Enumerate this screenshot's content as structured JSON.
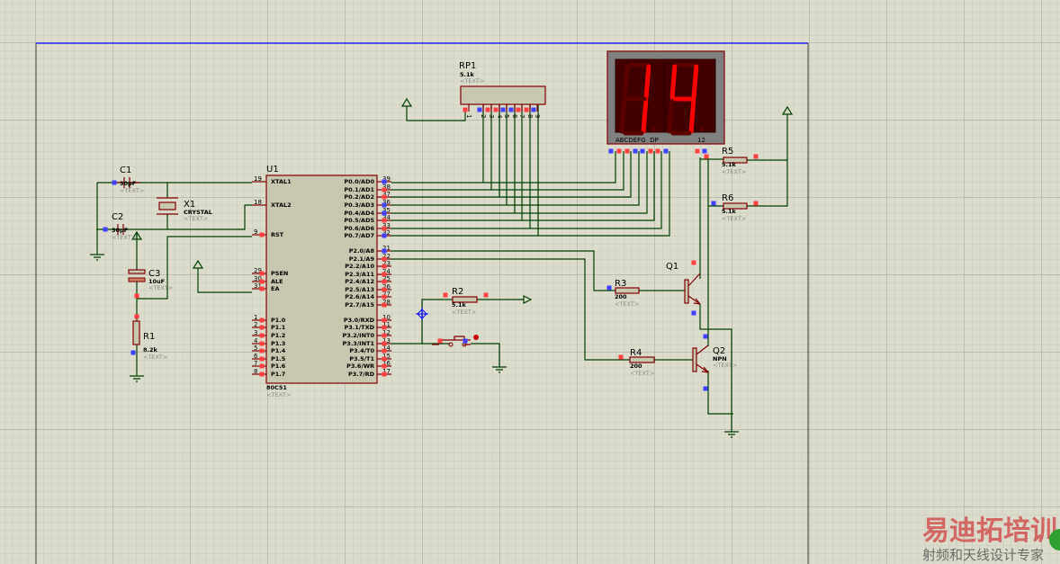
{
  "colors": {
    "wire": "#004000",
    "component": "#800000",
    "body_fill": "#c8c8b0",
    "pin_red": "#ff4040",
    "pin_blue": "#4040ff",
    "segment_on": "#ff0000",
    "segment_off": "#5a0000",
    "sheet_top": "#0000ff"
  },
  "u1": {
    "ref": "U1",
    "part": "80C51",
    "text": "<TEXT>",
    "left_pins": [
      {
        "num": "19",
        "name": "XTAL1"
      },
      {
        "num": "18",
        "name": "XTAL2"
      },
      {
        "num": "9",
        "name": "RST"
      },
      {
        "num": "29",
        "name": "PSEN"
      },
      {
        "num": "30",
        "name": "ALE"
      },
      {
        "num": "31",
        "name": "EA"
      },
      {
        "num": "1",
        "name": "P1.0"
      },
      {
        "num": "2",
        "name": "P1.1"
      },
      {
        "num": "3",
        "name": "P1.2"
      },
      {
        "num": "4",
        "name": "P1.3"
      },
      {
        "num": "5",
        "name": "P1.4"
      },
      {
        "num": "6",
        "name": "P1.5"
      },
      {
        "num": "7",
        "name": "P1.6"
      },
      {
        "num": "8",
        "name": "P1.7"
      }
    ],
    "right_pins": [
      {
        "num": "39",
        "name": "P0.0/AD0"
      },
      {
        "num": "38",
        "name": "P0.1/AD1"
      },
      {
        "num": "37",
        "name": "P0.2/AD2"
      },
      {
        "num": "36",
        "name": "P0.3/AD3"
      },
      {
        "num": "35",
        "name": "P0.4/AD4"
      },
      {
        "num": "34",
        "name": "P0.5/AD5"
      },
      {
        "num": "33",
        "name": "P0.6/AD6"
      },
      {
        "num": "32",
        "name": "P0.7/AD7"
      },
      {
        "num": "21",
        "name": "P2.0/A8"
      },
      {
        "num": "22",
        "name": "P2.1/A9"
      },
      {
        "num": "23",
        "name": "P2.2/A10"
      },
      {
        "num": "24",
        "name": "P2.3/A11"
      },
      {
        "num": "25",
        "name": "P2.4/A12"
      },
      {
        "num": "26",
        "name": "P2.5/A13"
      },
      {
        "num": "27",
        "name": "P2.6/A14"
      },
      {
        "num": "28",
        "name": "P2.7/A15"
      },
      {
        "num": "10",
        "name": "P3.0/RXD"
      },
      {
        "num": "11",
        "name": "P3.1/TXD"
      },
      {
        "num": "12",
        "name": "P3.2/INT0"
      },
      {
        "num": "13",
        "name": "P3.3/INT1"
      },
      {
        "num": "14",
        "name": "P3.4/T0"
      },
      {
        "num": "15",
        "name": "P3.5/T1"
      },
      {
        "num": "16",
        "name": "P3.6/WR"
      },
      {
        "num": "17",
        "name": "P3.7/RD"
      }
    ]
  },
  "rp1": {
    "ref": "RP1",
    "value": "5.1k",
    "text": "<TEXT>",
    "pins": [
      "1",
      "2",
      "3",
      "4",
      "5",
      "6",
      "7",
      "8",
      "9"
    ]
  },
  "display": {
    "digits": "14",
    "pin_labels": "ABCDEFG  DP",
    "common_labels": "12"
  },
  "components": [
    {
      "id": "c1",
      "ref": "C1",
      "value": "30pF",
      "text": "<TEXT>"
    },
    {
      "id": "c2",
      "ref": "C2",
      "value": "30pF",
      "text": "<TEXT>"
    },
    {
      "id": "x1",
      "ref": "X1",
      "value": "CRYSTAL",
      "text": "<TEXT>"
    },
    {
      "id": "c3",
      "ref": "C3",
      "value": "10uF",
      "text": "<TEXT>"
    },
    {
      "id": "r1",
      "ref": "R1",
      "value": "8.2k",
      "text": "<TEXT>"
    },
    {
      "id": "r2",
      "ref": "R2",
      "value": "5.1k",
      "text": "<TEXT>"
    },
    {
      "id": "r3",
      "ref": "R3",
      "value": "200",
      "text": "<TEXT>"
    },
    {
      "id": "r4",
      "ref": "R4",
      "value": "200",
      "text": "<TEXT>"
    },
    {
      "id": "q1",
      "ref": "Q1",
      "value": "",
      "text": ""
    },
    {
      "id": "q2",
      "ref": "Q2",
      "value": "NPN",
      "text": "<TEXT>"
    },
    {
      "id": "r5",
      "ref": "R5",
      "value": "5.1k",
      "text": "<TEXT>"
    },
    {
      "id": "r6",
      "ref": "R6",
      "value": "5.1k",
      "text": "<TEXT>"
    }
  ],
  "watermark": {
    "line1": "易迪拓培训",
    "line2": "射频和天线设计专家"
  }
}
